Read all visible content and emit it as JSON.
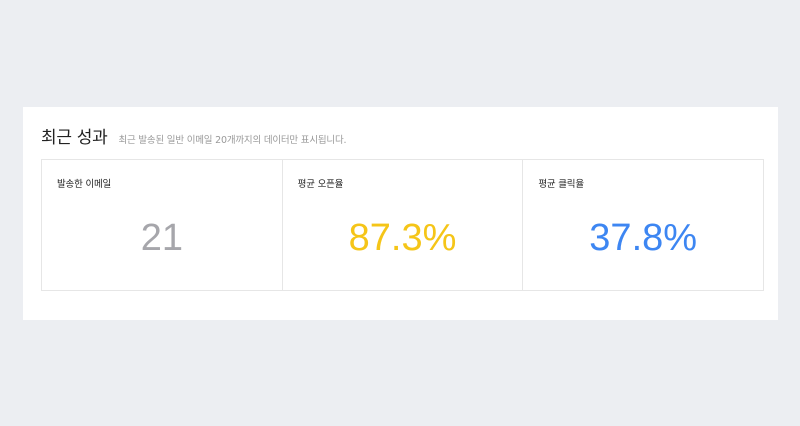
{
  "panel": {
    "title": "최근 성과",
    "subtitle": "최근 발송된 일반 이메일 20개까지의 데이터만 표시됩니다."
  },
  "cards": [
    {
      "label": "발송한 이메일",
      "value": "21",
      "color": "#a6a6ab"
    },
    {
      "label": "평균 오픈율",
      "value": "87.3%",
      "color": "#f5c518"
    },
    {
      "label": "평균 클릭율",
      "value": "37.8%",
      "color": "#3d86f2"
    }
  ]
}
